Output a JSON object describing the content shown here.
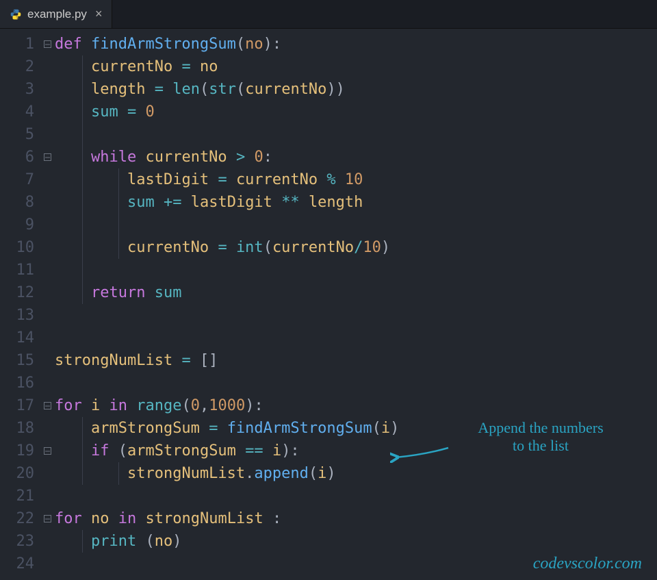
{
  "tab": {
    "filename": "example.py",
    "close_glyph": "×"
  },
  "lines": [
    {
      "n": 1,
      "fold": true,
      "guides": [],
      "tokens": [
        [
          "kw",
          "def "
        ],
        [
          "fn",
          "findArmStrongSum"
        ],
        [
          "pn",
          "("
        ],
        [
          "prm",
          "no"
        ],
        [
          "pn",
          "):"
        ]
      ]
    },
    {
      "n": 2,
      "fold": false,
      "guides": [
        "g1"
      ],
      "tokens": [
        [
          "plain",
          "    "
        ],
        [
          "id",
          "currentNo"
        ],
        [
          "plain",
          " "
        ],
        [
          "op",
          "="
        ],
        [
          "plain",
          " "
        ],
        [
          "id",
          "no"
        ]
      ]
    },
    {
      "n": 3,
      "fold": false,
      "guides": [
        "g1"
      ],
      "tokens": [
        [
          "plain",
          "    "
        ],
        [
          "id",
          "length"
        ],
        [
          "plain",
          " "
        ],
        [
          "op",
          "="
        ],
        [
          "plain",
          " "
        ],
        [
          "bi",
          "len"
        ],
        [
          "pn",
          "("
        ],
        [
          "bi",
          "str"
        ],
        [
          "pn",
          "("
        ],
        [
          "id",
          "currentNo"
        ],
        [
          "pn",
          "))"
        ]
      ]
    },
    {
      "n": 4,
      "fold": false,
      "guides": [
        "g1"
      ],
      "tokens": [
        [
          "plain",
          "    "
        ],
        [
          "bi",
          "sum"
        ],
        [
          "plain",
          " "
        ],
        [
          "op",
          "="
        ],
        [
          "plain",
          " "
        ],
        [
          "num",
          "0"
        ]
      ]
    },
    {
      "n": 5,
      "fold": false,
      "guides": [
        "g1"
      ],
      "tokens": []
    },
    {
      "n": 6,
      "fold": true,
      "guides": [
        "g1"
      ],
      "tokens": [
        [
          "plain",
          "    "
        ],
        [
          "kw",
          "while"
        ],
        [
          "plain",
          " "
        ],
        [
          "id",
          "currentNo"
        ],
        [
          "plain",
          " "
        ],
        [
          "op",
          ">"
        ],
        [
          "plain",
          " "
        ],
        [
          "num",
          "0"
        ],
        [
          "pn",
          ":"
        ]
      ]
    },
    {
      "n": 7,
      "fold": false,
      "guides": [
        "g1",
        "g2"
      ],
      "tokens": [
        [
          "plain",
          "        "
        ],
        [
          "id",
          "lastDigit"
        ],
        [
          "plain",
          " "
        ],
        [
          "op",
          "="
        ],
        [
          "plain",
          " "
        ],
        [
          "id",
          "currentNo"
        ],
        [
          "plain",
          " "
        ],
        [
          "op",
          "%"
        ],
        [
          "plain",
          " "
        ],
        [
          "num",
          "10"
        ]
      ]
    },
    {
      "n": 8,
      "fold": false,
      "guides": [
        "g1",
        "g2"
      ],
      "tokens": [
        [
          "plain",
          "        "
        ],
        [
          "bi",
          "sum"
        ],
        [
          "plain",
          " "
        ],
        [
          "op",
          "+="
        ],
        [
          "plain",
          " "
        ],
        [
          "id",
          "lastDigit"
        ],
        [
          "plain",
          " "
        ],
        [
          "op",
          "**"
        ],
        [
          "plain",
          " "
        ],
        [
          "id",
          "length"
        ]
      ]
    },
    {
      "n": 9,
      "fold": false,
      "guides": [
        "g1",
        "g2"
      ],
      "tokens": []
    },
    {
      "n": 10,
      "fold": false,
      "guides": [
        "g1",
        "g2"
      ],
      "tokens": [
        [
          "plain",
          "        "
        ],
        [
          "id",
          "currentNo"
        ],
        [
          "plain",
          " "
        ],
        [
          "op",
          "="
        ],
        [
          "plain",
          " "
        ],
        [
          "bi",
          "int"
        ],
        [
          "pn",
          "("
        ],
        [
          "id",
          "currentNo"
        ],
        [
          "op",
          "/"
        ],
        [
          "num",
          "10"
        ],
        [
          "pn",
          ")"
        ]
      ]
    },
    {
      "n": 11,
      "fold": false,
      "guides": [
        "g1"
      ],
      "tokens": []
    },
    {
      "n": 12,
      "fold": false,
      "guides": [
        "g1"
      ],
      "tokens": [
        [
          "plain",
          "    "
        ],
        [
          "kw",
          "return"
        ],
        [
          "plain",
          " "
        ],
        [
          "bi",
          "sum"
        ]
      ]
    },
    {
      "n": 13,
      "fold": false,
      "guides": [],
      "tokens": []
    },
    {
      "n": 14,
      "fold": false,
      "guides": [],
      "tokens": []
    },
    {
      "n": 15,
      "fold": false,
      "guides": [],
      "tokens": [
        [
          "id",
          "strongNumList"
        ],
        [
          "plain",
          " "
        ],
        [
          "op",
          "="
        ],
        [
          "plain",
          " "
        ],
        [
          "pn",
          "[]"
        ]
      ]
    },
    {
      "n": 16,
      "fold": false,
      "guides": [],
      "tokens": []
    },
    {
      "n": 17,
      "fold": true,
      "guides": [],
      "tokens": [
        [
          "kw",
          "for"
        ],
        [
          "plain",
          " "
        ],
        [
          "id",
          "i"
        ],
        [
          "plain",
          " "
        ],
        [
          "kw",
          "in"
        ],
        [
          "plain",
          " "
        ],
        [
          "bi",
          "range"
        ],
        [
          "pn",
          "("
        ],
        [
          "num",
          "0"
        ],
        [
          "pn",
          ","
        ],
        [
          "num",
          "1000"
        ],
        [
          "pn",
          "):"
        ]
      ]
    },
    {
      "n": 18,
      "fold": false,
      "guides": [
        "g1"
      ],
      "tokens": [
        [
          "plain",
          "    "
        ],
        [
          "id",
          "armStrongSum"
        ],
        [
          "plain",
          " "
        ],
        [
          "op",
          "="
        ],
        [
          "plain",
          " "
        ],
        [
          "call",
          "findArmStrongSum"
        ],
        [
          "pn",
          "("
        ],
        [
          "id",
          "i"
        ],
        [
          "pn",
          ")"
        ]
      ]
    },
    {
      "n": 19,
      "fold": true,
      "guides": [
        "g1"
      ],
      "tokens": [
        [
          "plain",
          "    "
        ],
        [
          "kw",
          "if"
        ],
        [
          "plain",
          " "
        ],
        [
          "pn",
          "("
        ],
        [
          "id",
          "armStrongSum"
        ],
        [
          "plain",
          " "
        ],
        [
          "op",
          "=="
        ],
        [
          "plain",
          " "
        ],
        [
          "id",
          "i"
        ],
        [
          "pn",
          "):"
        ]
      ]
    },
    {
      "n": 20,
      "fold": false,
      "guides": [
        "g1",
        "g2"
      ],
      "tokens": [
        [
          "plain",
          "        "
        ],
        [
          "id",
          "strongNumList"
        ],
        [
          "pn",
          "."
        ],
        [
          "call",
          "append"
        ],
        [
          "pn",
          "("
        ],
        [
          "id",
          "i"
        ],
        [
          "pn",
          ")"
        ]
      ]
    },
    {
      "n": 21,
      "fold": false,
      "guides": [],
      "tokens": []
    },
    {
      "n": 22,
      "fold": true,
      "guides": [],
      "tokens": [
        [
          "kw",
          "for"
        ],
        [
          "plain",
          " "
        ],
        [
          "id",
          "no"
        ],
        [
          "plain",
          " "
        ],
        [
          "kw",
          "in"
        ],
        [
          "plain",
          " "
        ],
        [
          "id",
          "strongNumList"
        ],
        [
          "plain",
          " "
        ],
        [
          "pn",
          ":"
        ]
      ]
    },
    {
      "n": 23,
      "fold": false,
      "guides": [
        "g1"
      ],
      "tokens": [
        [
          "plain",
          "    "
        ],
        [
          "bi",
          "print"
        ],
        [
          "plain",
          " "
        ],
        [
          "pn",
          "("
        ],
        [
          "id",
          "no"
        ],
        [
          "pn",
          ")"
        ]
      ]
    },
    {
      "n": 24,
      "fold": false,
      "guides": [],
      "tokens": []
    }
  ],
  "annotation": {
    "line1": "Append the numbers",
    "line2": "to the list"
  },
  "footer": "codevscolor.com"
}
